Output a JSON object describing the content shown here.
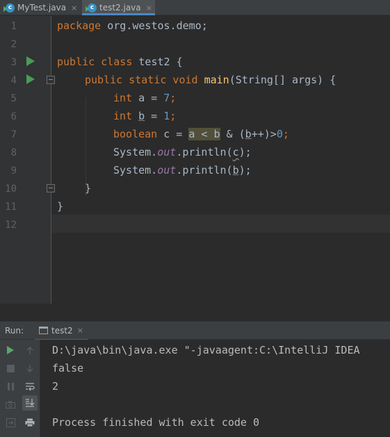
{
  "tabs": [
    {
      "label": "MyTest.java",
      "icon": "java-class-icon",
      "active": false
    },
    {
      "label": "test2.java",
      "icon": "java-class-icon",
      "active": true
    }
  ],
  "tab_close_glyph": "×",
  "editor": {
    "line_numbers": [
      "1",
      "2",
      "3",
      "4",
      "5",
      "6",
      "7",
      "8",
      "9",
      "10",
      "11",
      "12"
    ],
    "code": {
      "l1_kw": "package",
      "l1_rest": " org.westos.demo;",
      "l3_kw": "public class",
      "l3_rest": " test2 {",
      "l4_kw": "public static void",
      "l4_fn": "main",
      "l4_rest": "(String[] args) {",
      "l5_kw": "int",
      "l5_mid": " a = ",
      "l5_num": "7",
      "l5_end": ";",
      "l6_kw": "int",
      "l6_mid1": " ",
      "l6_var": "b",
      "l6_mid2": " = ",
      "l6_num": "1",
      "l6_end": ";",
      "l7_kw": "boolean",
      "l7_mid": " c = ",
      "l7_hl": "a < b",
      "l7_amp": " & (",
      "l7_b": "b",
      "l7_rest": "++)>",
      "l7_num": "0",
      "l7_end": ";",
      "l8_a": "System.",
      "l8_out": "out",
      "l8_b": ".println(",
      "l8_var": "c",
      "l8_end": ");",
      "l9_a": "System.",
      "l9_out": "out",
      "l9_b": ".println(",
      "l9_var": "b",
      "l9_end": ");",
      "l10": "}",
      "l11": "}"
    }
  },
  "run_panel": {
    "title": "Run:",
    "tab_label": "test2",
    "toolbar": [
      "run-icon",
      "stop-icon",
      "pause-icon",
      "camera-icon",
      "exit-icon",
      "up-arrow-icon",
      "down-arrow-icon",
      "soft-wrap-icon",
      "scroll-to-end-icon",
      "print-icon"
    ],
    "console": [
      "D:\\java\\bin\\java.exe \"-javaagent:C:\\IntelliJ IDEA",
      "false",
      "2",
      "",
      "Process finished with exit code 0"
    ]
  }
}
